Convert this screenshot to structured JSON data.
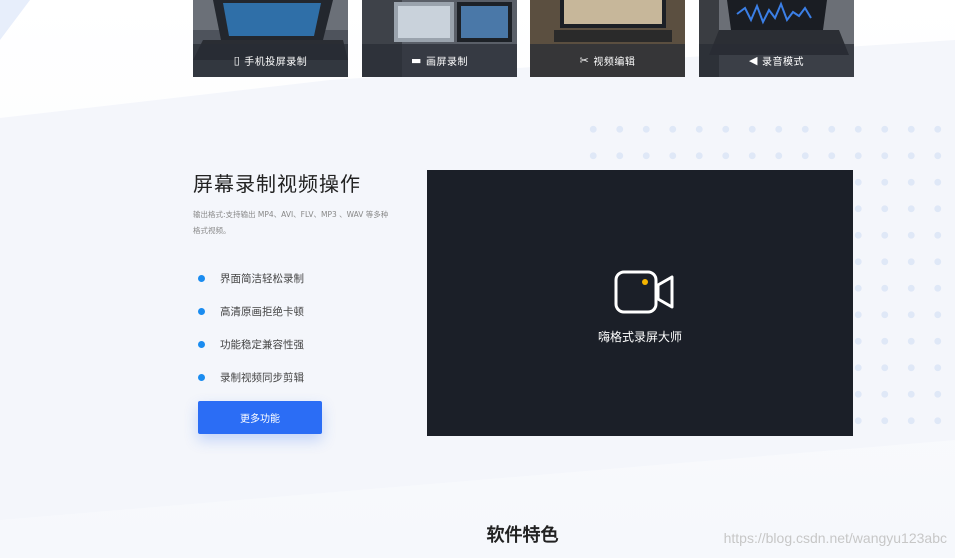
{
  "modes": [
    {
      "label": "手机投屏录制",
      "icon": "phone-icon"
    },
    {
      "label": "画屏录制",
      "icon": "window-icon"
    },
    {
      "label": "视频编辑",
      "icon": "scissors-icon"
    },
    {
      "label": "录音模式",
      "icon": "speaker-icon"
    }
  ],
  "section": {
    "title": "屏幕录制视频操作",
    "description": "输出格式:支持输出 MP4、AVI、FLV、MP3 、WAV 等多种格式视频。",
    "features": [
      "界面简洁轻松录制",
      "高清原画拒绝卡顿",
      "功能稳定兼容性强",
      "录制视频同步剪辑"
    ],
    "more_button": "更多功能"
  },
  "player": {
    "label": "嗨格式录屏大师",
    "icon": "video-camera-icon",
    "accent": "#f5b400"
  },
  "features_heading": "软件特色",
  "watermark": "https://blog.csdn.net/wangyu123abc",
  "colors": {
    "primary": "#2b6df5",
    "bullet": "#1a8cf0",
    "player_bg": "#1b1f28",
    "dots": "#dfe8f7"
  }
}
